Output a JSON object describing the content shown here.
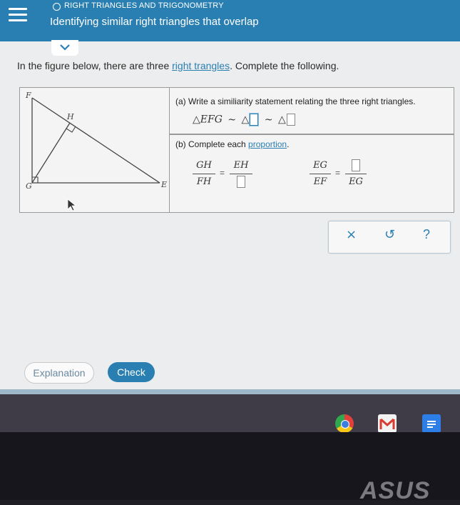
{
  "header": {
    "topic": "RIGHT TRIANGLES AND TRIGONOMETRY",
    "title": "Identifying similar right triangles that overlap"
  },
  "prompt": {
    "before": "In the figure below, there are three ",
    "link": "right trangles",
    "after": ". Complete the following."
  },
  "figure": {
    "labels": {
      "F": "F",
      "H": "H",
      "G": "G",
      "E": "E"
    }
  },
  "part_a": {
    "label": "(a) Write a similiarity statement relating the three right triangles.",
    "triangle_symbol": "△",
    "first_triangle": "EFG",
    "similar_symbol": "~"
  },
  "part_b": {
    "label_before": "(b) Complete each ",
    "label_link": "proportion",
    "label_after": ".",
    "prop1": {
      "num1": "GH",
      "den1": "FH",
      "num2": "EH"
    },
    "prop2": {
      "num1": "EG",
      "den1": "EF",
      "den2": "EG"
    },
    "equals": "="
  },
  "tools": {
    "clear": "×",
    "undo": "↺",
    "help": "?"
  },
  "buttons": {
    "explanation": "Explanation",
    "check": "Check"
  },
  "brand": "ASUS",
  "colors": {
    "primary": "#2a7fb2",
    "header_bg": "#2a7fb2",
    "link": "#2a7fb2"
  }
}
